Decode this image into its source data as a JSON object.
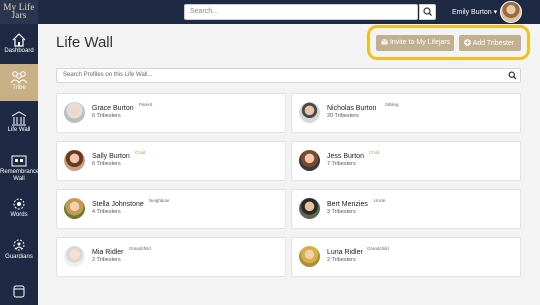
{
  "topbar": {
    "logo_text": "My Life Jars",
    "search_placeholder": "Search...",
    "user_name": "Emily Burton ▾"
  },
  "sidebar": {
    "items": [
      {
        "label": "Dashboard",
        "icon": "house-icon"
      },
      {
        "label": "Tribe",
        "icon": "people-icon",
        "active": true
      },
      {
        "label": "Life Wall",
        "icon": "wall-icon"
      },
      {
        "label": "Remembrance Wall",
        "icon": "remembrance-icon"
      },
      {
        "label": "Words",
        "icon": "words-icon"
      },
      {
        "label": "Guardians",
        "icon": "guardians-icon"
      },
      {
        "label": "Jars",
        "icon": "jar-icon"
      }
    ]
  },
  "page": {
    "title": "Life Wall",
    "invite_button": "Invite to My Lifejars",
    "add_button": "Add Tribester",
    "profile_search_placeholder": "Search Profiles on this Life Wall..."
  },
  "profiles": [
    {
      "name": "Grace Burton",
      "relation": "Parent",
      "count": "6 Tribesters"
    },
    {
      "name": "Nicholas Burton",
      "relation": "Sibling",
      "count": "20 Tribesters"
    },
    {
      "name": "Sally Burton",
      "relation": "Child",
      "count": "6 Tribesters"
    },
    {
      "name": "Jess Burton",
      "relation": "Child",
      "count": "7 Tribesters"
    },
    {
      "name": "Stella Johnstone",
      "relation": "Neighbour",
      "count": "4 Tribesters"
    },
    {
      "name": "Bert Menzies",
      "relation": "Uncle",
      "count": "3 Tribesters"
    },
    {
      "name": "Mia Ridler",
      "relation": "Grandchild",
      "count": "2 Tribesters"
    },
    {
      "name": "Luna Ridler",
      "relation": "Grandchild",
      "count": "2 Tribesters"
    }
  ],
  "colors": {
    "navy": "#1e2a44",
    "tan": "#c8b086",
    "highlight": "#f0c020",
    "child_relation": "#c0a060"
  }
}
